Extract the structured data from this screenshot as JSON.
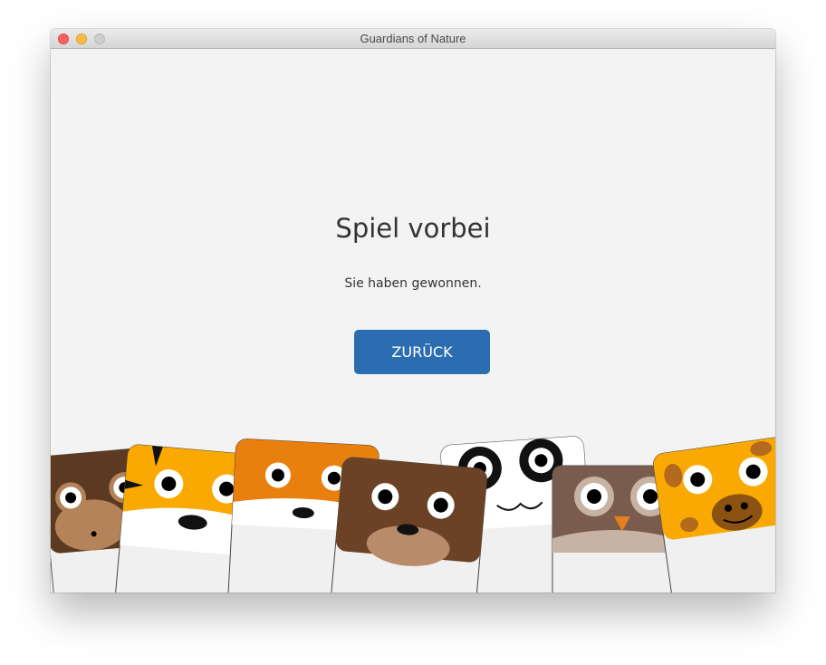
{
  "window": {
    "title": "Guardians of Nature"
  },
  "game_over": {
    "heading": "Spiel vorbei",
    "message": "Sie haben gewonnen.",
    "back_label": "ZURÜCK"
  },
  "colors": {
    "button": "#2b6db0",
    "background": "#f3f3f3"
  },
  "animals": [
    "monkey",
    "tiger",
    "fox",
    "bear",
    "panda",
    "owl",
    "giraffe"
  ]
}
